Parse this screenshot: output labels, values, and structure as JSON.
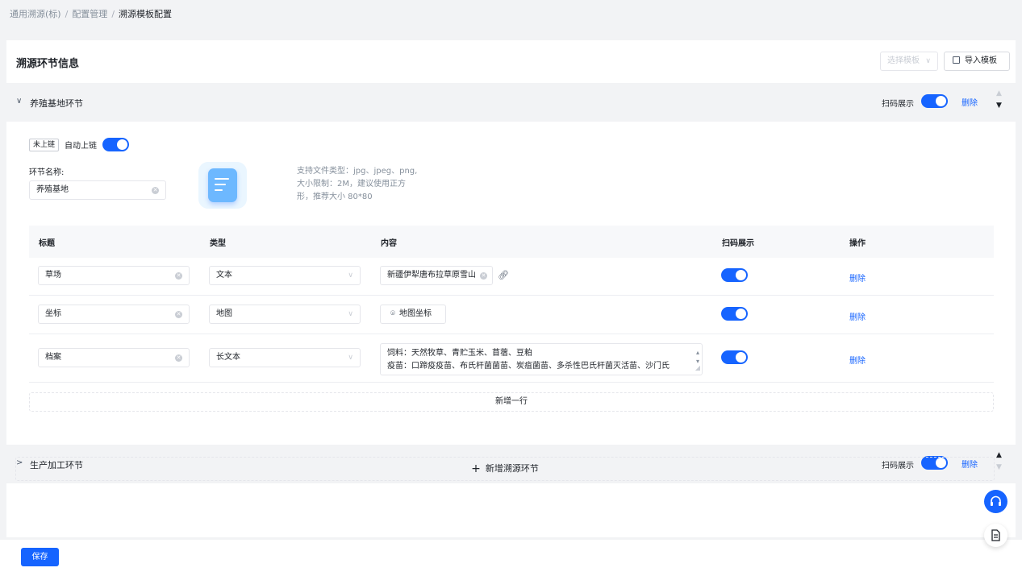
{
  "breadcrumb": [
    "通用溯源(标)",
    "配置管理",
    "溯源模板配置"
  ],
  "breadcrumb_sep": "/",
  "panel": {
    "title": "溯源环节信息",
    "template_select_placeholder": "选择模板",
    "import_label": "导入模板"
  },
  "sections": [
    {
      "title": "养殖基地环节",
      "scan_label": "扫码展示",
      "delete_label": "删除",
      "expanded": true,
      "scan_on": true
    },
    {
      "title": "生产加工环节",
      "scan_label": "扫码展示",
      "delete_label": "删除",
      "expanded": false,
      "scan_on": true
    }
  ],
  "body": {
    "chain_tag": "未上链",
    "auto_chain_label": "自动上链",
    "name_label": "环节名称:",
    "name_value": "养殖基地",
    "upload_hint": [
      "支持文件类型：jpg、jpeg、png,",
      "大小限制：2M，建议使用正方",
      "形，推荐大小 80*80"
    ]
  },
  "table": {
    "headers": [
      "标题",
      "类型",
      "内容",
      "扫码展示",
      "操作"
    ],
    "rows": [
      {
        "title": "草场",
        "type": "文本",
        "content": "新疆伊犁唐布拉草原雪山",
        "scan": true,
        "action": "删除"
      },
      {
        "title": "坐标",
        "type": "地图",
        "content": "地图坐标",
        "scan": true,
        "action": "删除"
      },
      {
        "title": "档案",
        "type": "长文本",
        "content_lines": [
          "饲料：天然牧草、青贮玉米、苜蓿、豆粕",
          "疫苗：口蹄疫疫苗、布氏杆菌菌苗、炭疽菌苗、多杀性巴氏杆菌灭活苗、沙门氏"
        ],
        "scan": true,
        "action": "删除"
      }
    ],
    "add_row_label": "新增一行"
  },
  "add_section_label": "新增溯源环节",
  "save_label": "保存"
}
